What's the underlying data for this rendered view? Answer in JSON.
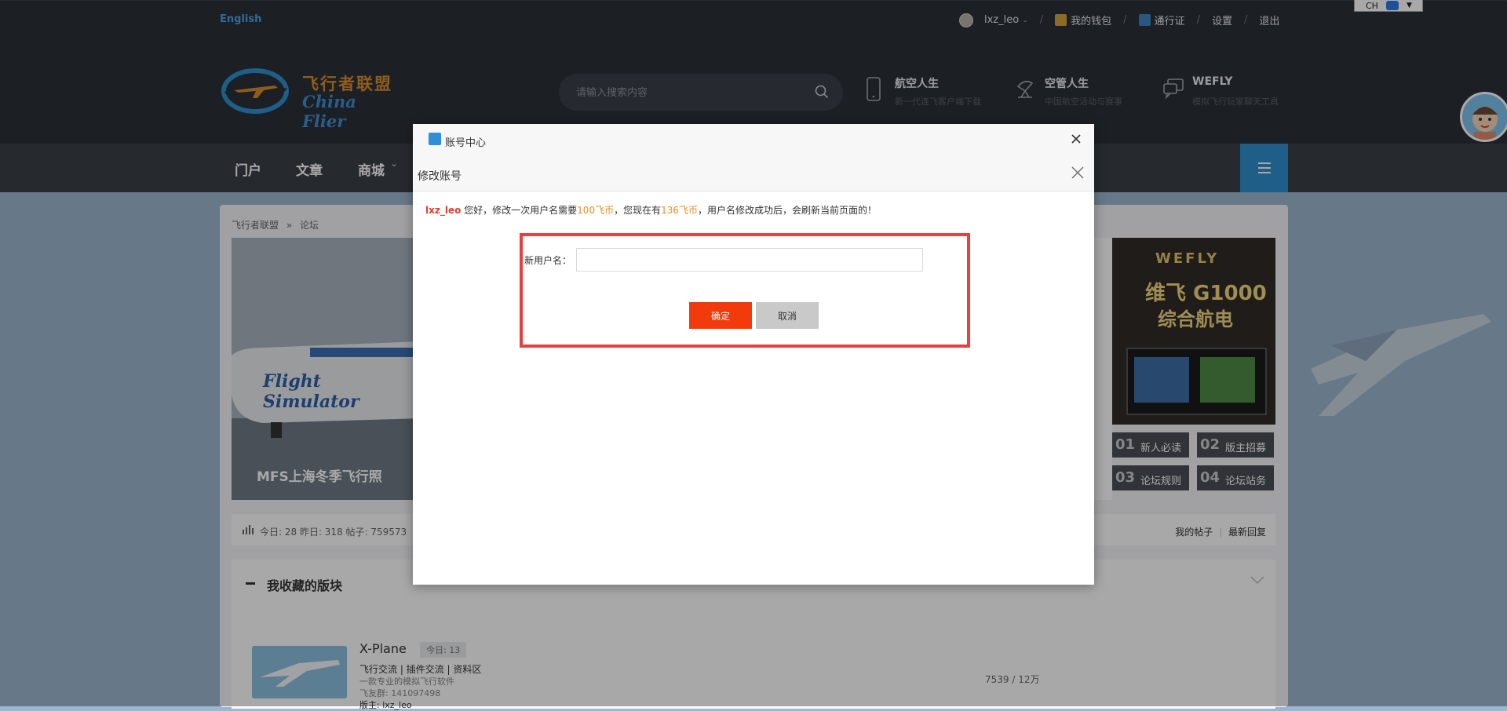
{
  "topbar": {
    "language": "English",
    "username": "lxz_leo",
    "wallet": "我的钱包",
    "pass": "通行证",
    "settings": "设置",
    "logout": "退出",
    "separator": "/"
  },
  "ime": {
    "label": "CH"
  },
  "header": {
    "logo_cn": "飞行者联盟",
    "logo_en": "China Flier",
    "search_placeholder": "请输入搜索内容",
    "items": [
      {
        "title": "航空人生",
        "subtitle": "新一代连飞客户端下载",
        "icon": "phone-icon"
      },
      {
        "title": "空管人生",
        "subtitle": "中国航空活动与赛事",
        "icon": "radar-icon"
      },
      {
        "title": "WEFLY",
        "subtitle": "模拟飞行玩家聊天工具",
        "icon": "chat-icon"
      }
    ]
  },
  "nav": {
    "items": [
      "门户",
      "文章",
      "商城"
    ],
    "dropdown_caret": "⌄"
  },
  "breadcrumb": {
    "home": "飞行者联盟",
    "sep": "»",
    "current": "论坛"
  },
  "slide": {
    "caption": "MFS上海冬季飞行照",
    "brand": "Flight Simulator"
  },
  "ad": {
    "brand": "WEFLY",
    "line1": "维飞 G1000",
    "line2": "综合航电"
  },
  "tiles": [
    {
      "num": "01",
      "label": "新人必读"
    },
    {
      "num": "02",
      "label": "版主招募"
    },
    {
      "num": "03",
      "label": "论坛规则"
    },
    {
      "num": "04",
      "label": "论坛站务"
    }
  ],
  "stats": {
    "text": "今日: 28   昨日: 318   帖子: 759573",
    "my_posts": "我的帖子",
    "latest": "最新回复"
  },
  "favorites": {
    "title": "我收藏的版块"
  },
  "forum": {
    "name": "X-Plane",
    "today": "今日: 13",
    "sub": "飞行交流 | 插件交流 | 资料区",
    "desc": "一款专业的模拟飞行软件",
    "group": "飞友群: 141097498",
    "moderator": "版主: lxz_leo",
    "counts": "7539 / 12万"
  },
  "dialog": {
    "outer_title": "账号中心",
    "inner_title": "修改账号",
    "msg_user": "lxz_leo",
    "msg_p1": " 您好，修改一次用户名需要",
    "msg_cost": "100飞币",
    "msg_p2": "，您现在有",
    "msg_balance": "136飞币",
    "msg_p3": "，用户名修改成功后，会刷新当前页面的！",
    "field_label": "新用户名：",
    "field_value": "",
    "confirm": "确定",
    "cancel": "取消"
  },
  "colors": {
    "accent_blue": "#2f8fcc",
    "confirm_red": "#f23a0c",
    "highlight_box": "#e8403d",
    "dark_header": "#2b2f36"
  }
}
